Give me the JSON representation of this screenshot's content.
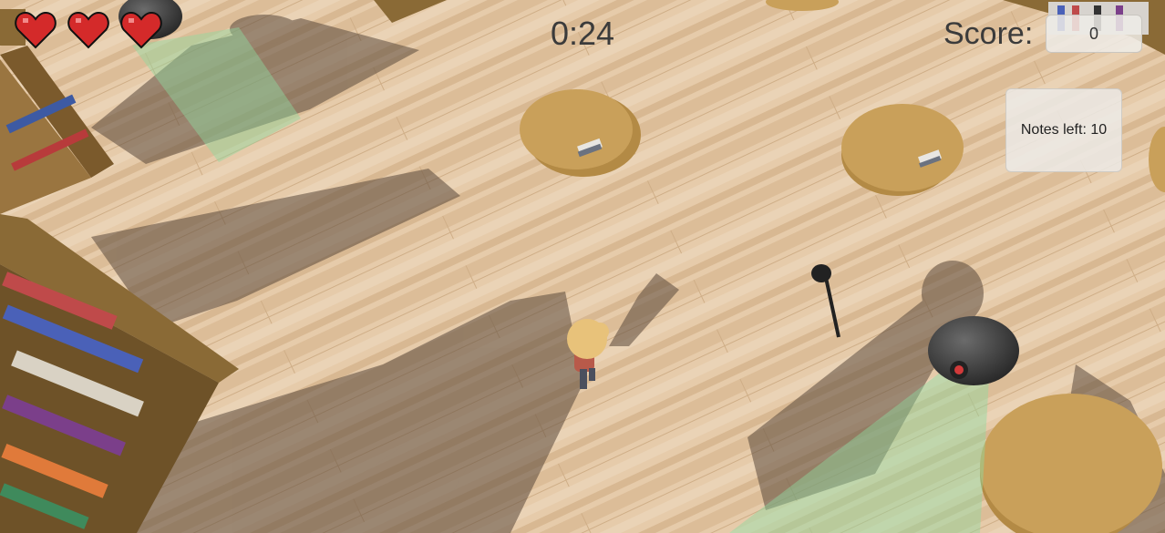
{
  "hud": {
    "timer": "0:24",
    "score_label": "Score:",
    "score_value": "0",
    "notes_left": "Notes left: 10",
    "lives": 3
  },
  "colors": {
    "floor": "#e3c8a6",
    "heart": "#d42a2a",
    "table": "#c9a05a",
    "shelf": "#8a6a36",
    "camera_cone": "#8fd9a0"
  },
  "icons": [
    "heart-icon",
    "book-stack-icon",
    "security-camera-icon",
    "player-character-icon"
  ]
}
